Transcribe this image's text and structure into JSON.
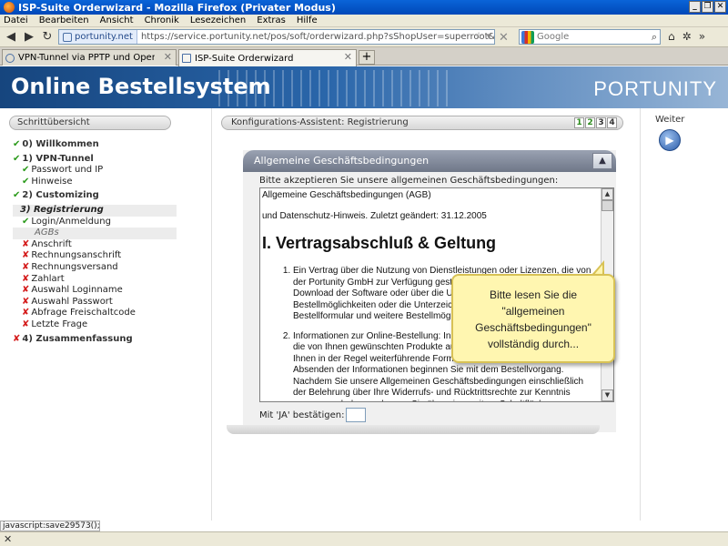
{
  "window": {
    "title": "ISP-Suite Orderwizard - Mozilla Firefox (Privater Modus)",
    "controls": {
      "minimize": "_",
      "restore": "❐",
      "close": "✕"
    }
  },
  "menu": [
    "Datei",
    "Bearbeiten",
    "Ansicht",
    "Chronik",
    "Lesezeichen",
    "Extras",
    "Hilfe"
  ],
  "nav": {
    "site_identity": "portunity.net",
    "url": "https://service.portunity.net/pos/soft/orderwizard.php?sShopUser=superroot&ProductGroup=96",
    "search_engine": "Google",
    "search_placeholder": "Google"
  },
  "tabs": [
    {
      "label": "VPN-Tunnel via PPTP und OpenVPN (Tarif...",
      "active": false
    },
    {
      "label": "ISP-Suite Orderwizard",
      "active": true
    }
  ],
  "banner": {
    "title": "Online Bestellsystem",
    "logo": "PORTUNITY"
  },
  "sidebar": {
    "header": "Schrittübersicht",
    "items": [
      {
        "label": "0) Willkommen",
        "status": "done"
      },
      {
        "label": "1) VPN-Tunnel",
        "status": "done"
      },
      {
        "label": "Passwort und IP",
        "status": "done"
      },
      {
        "label": "Hinweise",
        "status": "done"
      },
      {
        "label": "2) Customizing",
        "status": "done"
      },
      {
        "label": "3) Registrierung",
        "status": "current"
      },
      {
        "label": "Login/Anmeldung",
        "status": "done"
      },
      {
        "label": "AGBs",
        "status": "current"
      },
      {
        "label": "Anschrift",
        "status": "todo"
      },
      {
        "label": "Rechnungsanschrift",
        "status": "todo"
      },
      {
        "label": "Rechnungsversand",
        "status": "todo"
      },
      {
        "label": "Zahlart",
        "status": "todo"
      },
      {
        "label": "Auswahl Loginname",
        "status": "todo"
      },
      {
        "label": "Auswahl Passwort",
        "status": "todo"
      },
      {
        "label": "Abfrage Freischaltcode",
        "status": "todo"
      },
      {
        "label": "Letzte Frage",
        "status": "todo"
      },
      {
        "label": "4) Zusammenfassung",
        "status": "todo"
      }
    ]
  },
  "wizard": {
    "header": "Konfigurations-Assistent: Registrierung",
    "steps": [
      "1",
      "2",
      "3",
      "4"
    ],
    "steps_done": 2
  },
  "agb": {
    "title": "Allgemeine Geschäftsbedingungen",
    "collapse_icon": "▲",
    "prompt": "Bitte akzeptieren Sie unsere allgemeinen Geschäftsbedingungen:",
    "line1": "Allgemeine Geschäftsbedingungen (AGB)",
    "line2": "und Datenschutz-Hinweis. Zuletzt geändert: 31.12.2005",
    "heading": "I. Vertragsabschluß & Geltung",
    "item1": "Ein Vertrag über die Nutzung von Dienstleistungen oder Lizenzen, die von der Portunity GmbH zur Verfügung gestellt werden, kommt durch den Download der Software oder über die Umsetzung anderer Bestellmöglichkeiten oder die Unterzeichnung zustande, optional über ein Bestellformular und weitere Bestellmöglichkeiten.",
    "item2": "Informationen zur Online-Bestellung: In der Online-Bestellung können Sie die von Ihnen gewünschten Produkte auswählen. Für die Bestellung stehen Ihnen in der Regel weiterführende Formulare zur Verfügung. Durch das Absenden der Informationen beginnen Sie mit dem Bestellvorgang. Nachdem Sie unsere Allgemeinen Geschäftsbedingungen einschließlich der Belehrung über Ihre Widerrufs- und Rücktrittsrechte zur Kenntnis genommen haben, gelangen Sie über eine weitere Schaltfläche zur Eingabe Ihrer",
    "confirm_label": "Mit 'JA' bestätigen:",
    "confirm_value": ""
  },
  "tooltip": {
    "line1": "Bitte lesen Sie die",
    "line2": "\"allgemeinen",
    "line3": "Geschäftsbedingungen\"",
    "line4": "vollständig durch..."
  },
  "weiter": {
    "label": "Weiter",
    "icon": "▶"
  },
  "status": {
    "link": "javascript:save29573();",
    "close": "✕"
  }
}
